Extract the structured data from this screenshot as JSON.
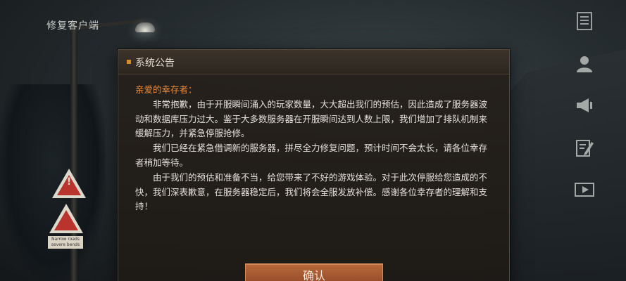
{
  "top_left": {
    "repair_client_label": "修复客户端"
  },
  "side_icons": [
    {
      "name": "notice-list-icon"
    },
    {
      "name": "user-icon"
    },
    {
      "name": "megaphone-icon"
    },
    {
      "name": "edit-note-icon"
    },
    {
      "name": "video-play-icon"
    }
  ],
  "dialog": {
    "title": "系统公告",
    "greeting": "亲爱的幸存者：",
    "paragraphs": [
      "非常抱歉，由于开服瞬间涌入的玩家数量，大大超出我们的预估，因此造成了服务器波动和数据库压力过大。鉴于大多数服务器在开服瞬间达到人数上限，我们增加了排队机制来缓解压力，并紧急停服抢修。",
      "我们已经在紧急借调新的服务器，拼尽全力修复问题，预计时间不会太长，请各位幸存者稍加等待。",
      "由于我们的预估和准备不当，给您带来了不好的游戏体验。对于此次停服给您造成的不快，我们深表歉意，在服务器稳定后，我们将会全服发放补偿。感谢各位幸存者的理解和支持！"
    ],
    "confirm_label": "确认"
  },
  "background": {
    "sign_plate_text": "Narrow roads severe bends"
  },
  "colors": {
    "accent_orange": "#e88a3a",
    "title_bullet": "#d78d2a",
    "button_top": "#b8693a",
    "button_bottom": "#8e4526",
    "dialog_bg": "#26211c",
    "body_text": "#e6e1da"
  }
}
